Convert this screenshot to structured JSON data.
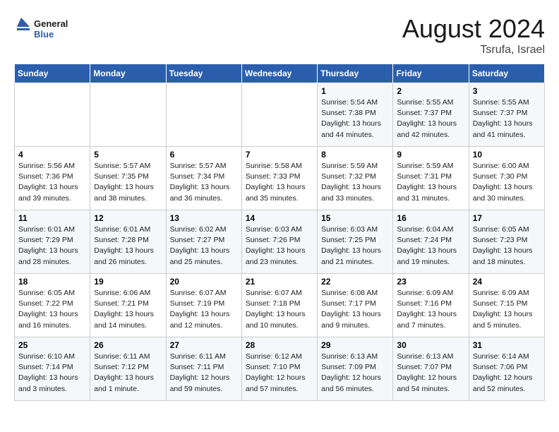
{
  "header": {
    "logo_general": "General",
    "logo_blue": "Blue",
    "month_year": "August 2024",
    "location": "Tsrufa, Israel"
  },
  "days_of_week": [
    "Sunday",
    "Monday",
    "Tuesday",
    "Wednesday",
    "Thursday",
    "Friday",
    "Saturday"
  ],
  "weeks": [
    [
      {
        "day": "",
        "info": ""
      },
      {
        "day": "",
        "info": ""
      },
      {
        "day": "",
        "info": ""
      },
      {
        "day": "",
        "info": ""
      },
      {
        "day": "1",
        "sunrise": "5:54 AM",
        "sunset": "7:38 PM",
        "daylight": "13 hours and 44 minutes."
      },
      {
        "day": "2",
        "sunrise": "5:55 AM",
        "sunset": "7:37 PM",
        "daylight": "13 hours and 42 minutes."
      },
      {
        "day": "3",
        "sunrise": "5:55 AM",
        "sunset": "7:37 PM",
        "daylight": "13 hours and 41 minutes."
      }
    ],
    [
      {
        "day": "4",
        "sunrise": "5:56 AM",
        "sunset": "7:36 PM",
        "daylight": "13 hours and 39 minutes."
      },
      {
        "day": "5",
        "sunrise": "5:57 AM",
        "sunset": "7:35 PM",
        "daylight": "13 hours and 38 minutes."
      },
      {
        "day": "6",
        "sunrise": "5:57 AM",
        "sunset": "7:34 PM",
        "daylight": "13 hours and 36 minutes."
      },
      {
        "day": "7",
        "sunrise": "5:58 AM",
        "sunset": "7:33 PM",
        "daylight": "13 hours and 35 minutes."
      },
      {
        "day": "8",
        "sunrise": "5:59 AM",
        "sunset": "7:32 PM",
        "daylight": "13 hours and 33 minutes."
      },
      {
        "day": "9",
        "sunrise": "5:59 AM",
        "sunset": "7:31 PM",
        "daylight": "13 hours and 31 minutes."
      },
      {
        "day": "10",
        "sunrise": "6:00 AM",
        "sunset": "7:30 PM",
        "daylight": "13 hours and 30 minutes."
      }
    ],
    [
      {
        "day": "11",
        "sunrise": "6:01 AM",
        "sunset": "7:29 PM",
        "daylight": "13 hours and 28 minutes."
      },
      {
        "day": "12",
        "sunrise": "6:01 AM",
        "sunset": "7:28 PM",
        "daylight": "13 hours and 26 minutes."
      },
      {
        "day": "13",
        "sunrise": "6:02 AM",
        "sunset": "7:27 PM",
        "daylight": "13 hours and 25 minutes."
      },
      {
        "day": "14",
        "sunrise": "6:03 AM",
        "sunset": "7:26 PM",
        "daylight": "13 hours and 23 minutes."
      },
      {
        "day": "15",
        "sunrise": "6:03 AM",
        "sunset": "7:25 PM",
        "daylight": "13 hours and 21 minutes."
      },
      {
        "day": "16",
        "sunrise": "6:04 AM",
        "sunset": "7:24 PM",
        "daylight": "13 hours and 19 minutes."
      },
      {
        "day": "17",
        "sunrise": "6:05 AM",
        "sunset": "7:23 PM",
        "daylight": "13 hours and 18 minutes."
      }
    ],
    [
      {
        "day": "18",
        "sunrise": "6:05 AM",
        "sunset": "7:22 PM",
        "daylight": "13 hours and 16 minutes."
      },
      {
        "day": "19",
        "sunrise": "6:06 AM",
        "sunset": "7:21 PM",
        "daylight": "13 hours and 14 minutes."
      },
      {
        "day": "20",
        "sunrise": "6:07 AM",
        "sunset": "7:19 PM",
        "daylight": "13 hours and 12 minutes."
      },
      {
        "day": "21",
        "sunrise": "6:07 AM",
        "sunset": "7:18 PM",
        "daylight": "13 hours and 10 minutes."
      },
      {
        "day": "22",
        "sunrise": "6:08 AM",
        "sunset": "7:17 PM",
        "daylight": "13 hours and 9 minutes."
      },
      {
        "day": "23",
        "sunrise": "6:09 AM",
        "sunset": "7:16 PM",
        "daylight": "13 hours and 7 minutes."
      },
      {
        "day": "24",
        "sunrise": "6:09 AM",
        "sunset": "7:15 PM",
        "daylight": "13 hours and 5 minutes."
      }
    ],
    [
      {
        "day": "25",
        "sunrise": "6:10 AM",
        "sunset": "7:14 PM",
        "daylight": "13 hours and 3 minutes."
      },
      {
        "day": "26",
        "sunrise": "6:11 AM",
        "sunset": "7:12 PM",
        "daylight": "13 hours and 1 minute."
      },
      {
        "day": "27",
        "sunrise": "6:11 AM",
        "sunset": "7:11 PM",
        "daylight": "12 hours and 59 minutes."
      },
      {
        "day": "28",
        "sunrise": "6:12 AM",
        "sunset": "7:10 PM",
        "daylight": "12 hours and 57 minutes."
      },
      {
        "day": "29",
        "sunrise": "6:13 AM",
        "sunset": "7:09 PM",
        "daylight": "12 hours and 56 minutes."
      },
      {
        "day": "30",
        "sunrise": "6:13 AM",
        "sunset": "7:07 PM",
        "daylight": "12 hours and 54 minutes."
      },
      {
        "day": "31",
        "sunrise": "6:14 AM",
        "sunset": "7:06 PM",
        "daylight": "12 hours and 52 minutes."
      }
    ]
  ]
}
